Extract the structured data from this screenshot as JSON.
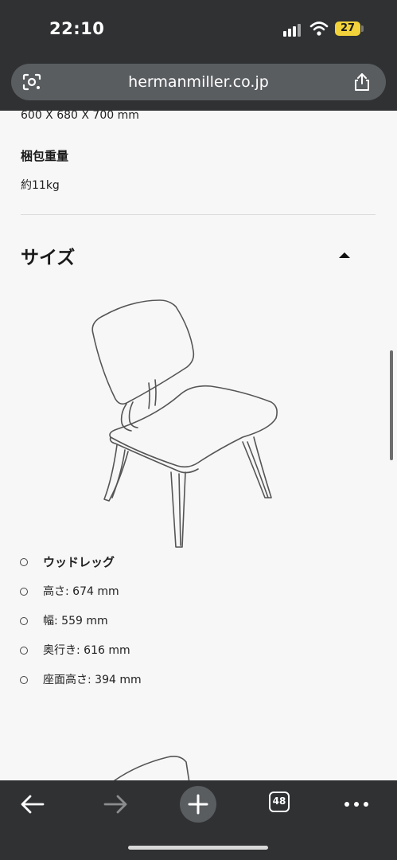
{
  "status_bar": {
    "time": "22:10",
    "battery": "27",
    "icons": [
      "signal-icon",
      "wifi-icon",
      "battery-icon"
    ]
  },
  "browser": {
    "url": "hermanmiller.co.jp",
    "icons": [
      "lens-icon",
      "share-icon"
    ]
  },
  "specs": {
    "dimensions": "600 X 680 X 700 mm",
    "package_weight_label": "梱包重量",
    "package_weight_value": "約11kg"
  },
  "size_section": {
    "title": "サイズ",
    "expanded": true,
    "items": [
      {
        "text": "ウッドレッグ",
        "bold": true
      },
      {
        "text": "高さ: 674 mm",
        "bold": false
      },
      {
        "text": "幅: 559 mm",
        "bold": false
      },
      {
        "text": "奥行き: 616 mm",
        "bold": false
      },
      {
        "text": "座面高さ: 394 mm",
        "bold": false
      }
    ]
  },
  "toolbar": {
    "tab_count": "48",
    "icons": [
      "back-arrow-icon",
      "forward-arrow-icon",
      "plus-icon",
      "tabs-icon",
      "more-icon"
    ]
  },
  "colors": {
    "chrome_bg": "#2f3133",
    "url_bar_bg": "#5a5d60",
    "page_bg": "#f7f7f7",
    "battery": "#f1d23a"
  }
}
